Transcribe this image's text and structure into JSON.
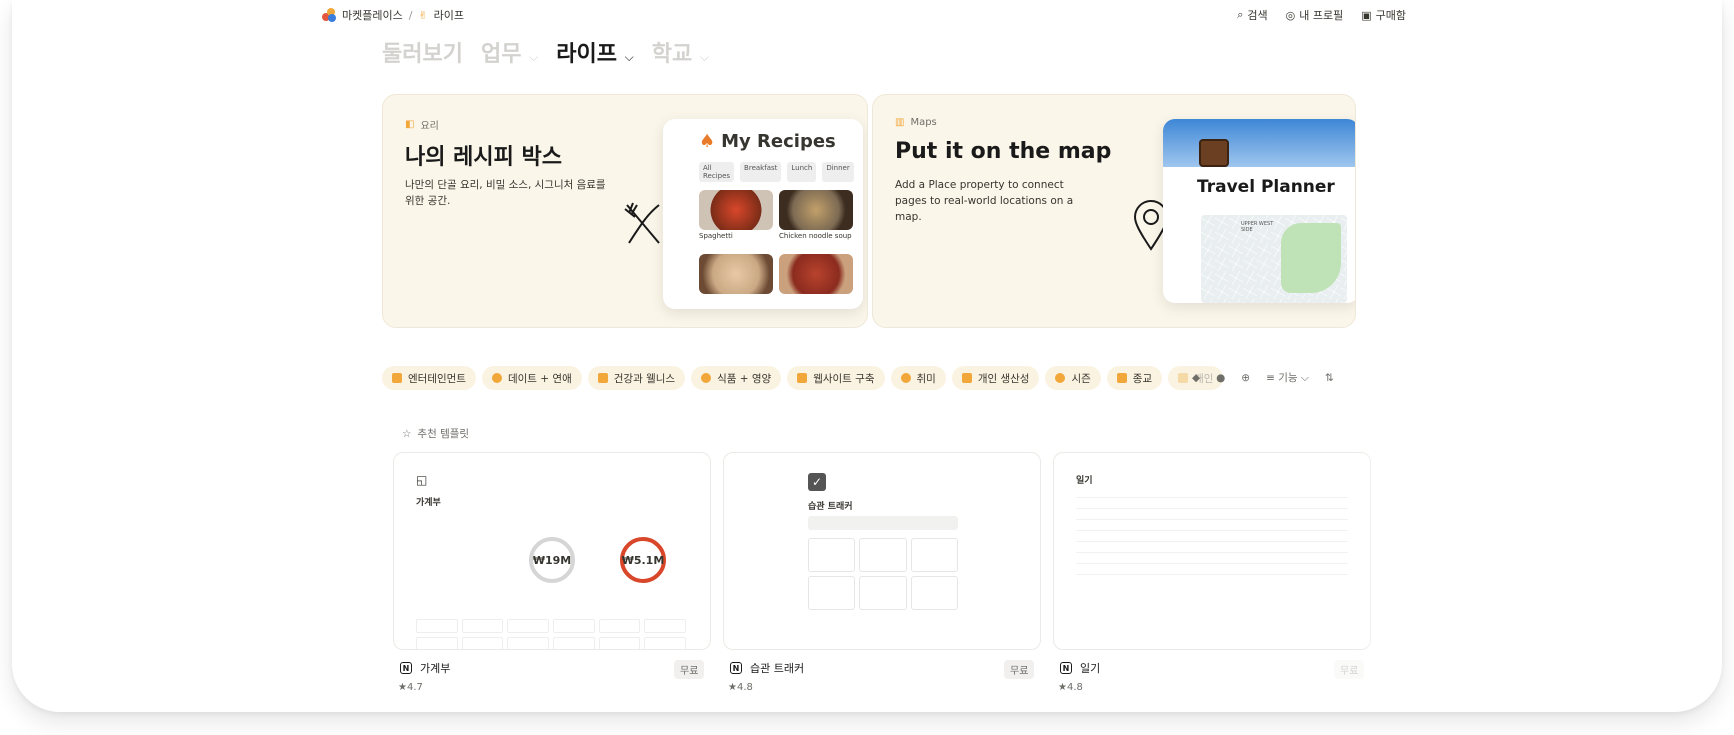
{
  "breadcrumb": {
    "root": "마켓플레이스",
    "separator": "/",
    "current": "라이프"
  },
  "top_actions": {
    "search": "검색",
    "profile": "내 프로필",
    "purchases": "구매함"
  },
  "categories": [
    {
      "label": "둘러보기"
    },
    {
      "label": "업무"
    },
    {
      "label": "라이프",
      "active": true
    },
    {
      "label": "학교"
    }
  ],
  "banners": [
    {
      "tag": "요리",
      "title": "나의 레시피 박스",
      "desc": "나만의 단골 요리, 비밀 소스, 시그니처 음료를 위한 공간.",
      "preview_title": "My Recipes",
      "pills": [
        "All Recipes",
        "Breakfast",
        "Lunch",
        "Dinner"
      ],
      "items": [
        "Spaghetti",
        "Chicken noodle soup"
      ]
    },
    {
      "tag": "Maps",
      "title": "Put it on the map",
      "desc": "Add a Place property to connect pages to real-world locations on a map.",
      "preview_title": "Travel Planner",
      "map_label": "UPPER WEST SIDE"
    }
  ],
  "filters": [
    "엔터테인먼트",
    "데이트 + 연애",
    "건강과 웰니스",
    "식품 + 영양",
    "웹사이트 구축",
    "취미",
    "개인 생산성",
    "시즌",
    "종교",
    "개인"
  ],
  "filter_tools": {
    "features": "기능"
  },
  "section_label": "추천 템플릿",
  "templates": [
    {
      "name": "가계부",
      "price": "무료",
      "rating": "4.7",
      "preview_title": "가계부",
      "amount1": "₩19M",
      "amount2": "₩5.1M"
    },
    {
      "name": "습관 트래커",
      "price": "무료",
      "rating": "4.8",
      "preview_title": "습관 트래커"
    },
    {
      "name": "일기",
      "price": "무료",
      "rating": "4.8",
      "preview_title": "일기"
    }
  ],
  "colors": {
    "banner_bg": "#fbf6ea",
    "chip_bg": "#fbf3e1",
    "accent": "#f2a73b"
  }
}
